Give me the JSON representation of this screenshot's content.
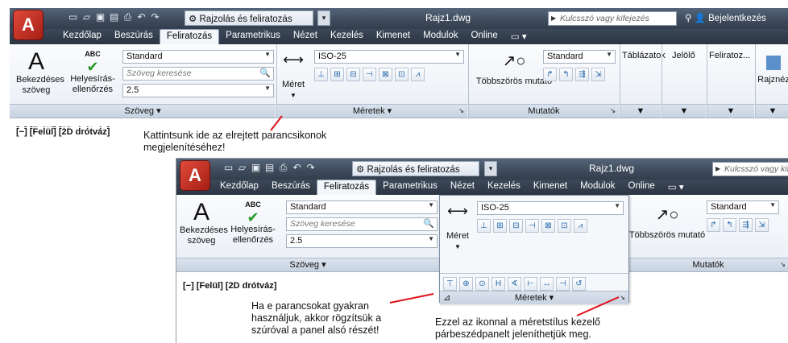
{
  "app": {
    "logo_letter": "A",
    "workspace": "Rajzolás és feliratozás",
    "doc_title": "Rajz1.dwg",
    "search_placeholder": "Kulcsszó vagy kifejezés",
    "search_placeholder_short": "Kulcsszó vagy kifeje",
    "login": "Bejelentkezés"
  },
  "tabs": [
    "Kezdőlap",
    "Beszúrás",
    "Feliratozás",
    "Parametrikus",
    "Nézet",
    "Kezelés",
    "Kimenet",
    "Modulok",
    "Online",
    "▭ ▾"
  ],
  "active_tab": "Feliratozás",
  "ribbon": {
    "text_panel": {
      "big_button_line1": "Bekezdéses",
      "big_button_line2": "szöveg",
      "spell_line1": "Helyesírás-",
      "spell_line2": "ellenőrzés",
      "abc": "ABC",
      "style": "Standard",
      "search": "Szöveg keresése",
      "height": "2.5",
      "title": "Szöveg ▾"
    },
    "dim_panel": {
      "button": "Méret",
      "style": "ISO-25",
      "title": "Méretek ▾"
    },
    "leader_panel": {
      "button": "Többszörös mutató",
      "style": "Standard",
      "title": "Mutatók"
    },
    "extra_panels": [
      "Táblázatok",
      "Jelölő",
      "Feliratoz..."
    ],
    "rajz": "Rajznéz"
  },
  "viewport_label": "[−] [Felül] [2D drótváz]",
  "notes": {
    "top": "Kattintsunk ide az elrejtett parancsikonok megjelenítéséhez!",
    "pin": "Ha e parancsokat gyakran használjuk, akkor rögzítsük a szúróval a panel alsó részét!",
    "dialog": "Ezzel az ikonnal a méretstílus kezelő párbeszédpanelt jeleníthetjük meg."
  },
  "colors": {
    "accent": "#d23a2b",
    "titlebar": "#3e4a5b",
    "arrow": "#e0101a"
  }
}
